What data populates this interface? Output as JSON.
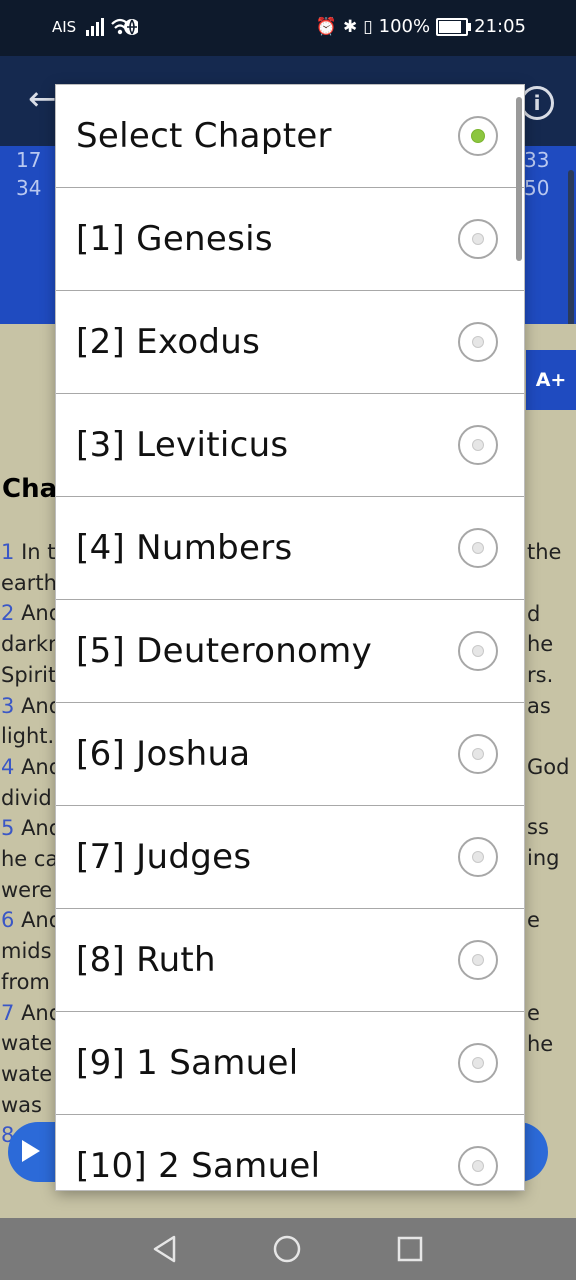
{
  "status_bar": {
    "carrier": "AIS",
    "battery": "100%",
    "time": "21:05",
    "battery_level": 1.0
  },
  "app_bar": {
    "back_icon": "arrow-back-icon",
    "info_icon": "info-icon",
    "info_glyph": "i"
  },
  "chapter_strip": {
    "visible_numbers": [
      "17",
      "33",
      "34",
      "50"
    ]
  },
  "reading": {
    "font_button": "A+",
    "chapter_heading_fragment": "Cha",
    "left_fragments": [
      {
        "num": "1",
        "text": "In t"
      },
      {
        "num": "",
        "text": "earth"
      },
      {
        "num": "2",
        "text": "And"
      },
      {
        "num": "",
        "text": "darkn"
      },
      {
        "num": "",
        "text": "Spirit"
      },
      {
        "num": "3",
        "text": "And"
      },
      {
        "num": "",
        "text": "light."
      },
      {
        "num": "4",
        "text": "And"
      },
      {
        "num": "",
        "text": "divid"
      },
      {
        "num": "5",
        "text": "And"
      },
      {
        "num": "",
        "text": "he ca"
      },
      {
        "num": "",
        "text": "were"
      },
      {
        "num": "6",
        "text": "And"
      },
      {
        "num": "",
        "text": "mids"
      },
      {
        "num": "",
        "text": "from"
      },
      {
        "num": "7",
        "text": "And"
      },
      {
        "num": "",
        "text": "wate"
      },
      {
        "num": "",
        "text": "wate"
      },
      {
        "num": "",
        "text": "was"
      },
      {
        "num": "8",
        "text": ""
      }
    ],
    "right_fragments": [
      "the",
      "d",
      "he",
      "rs.",
      "as",
      "God",
      "ss",
      "ing",
      "e",
      "e",
      "he"
    ]
  },
  "dialog": {
    "options": [
      {
        "label": "Select Chapter",
        "checked": true
      },
      {
        "label": "[1] Genesis",
        "checked": false
      },
      {
        "label": "[2] Exodus",
        "checked": false
      },
      {
        "label": "[3] Leviticus",
        "checked": false
      },
      {
        "label": "[4] Numbers",
        "checked": false
      },
      {
        "label": "[5] Deuteronomy",
        "checked": false
      },
      {
        "label": "[6] Joshua",
        "checked": false
      },
      {
        "label": "[7] Judges",
        "checked": false
      },
      {
        "label": "[8] Ruth",
        "checked": false
      },
      {
        "label": "[9] 1 Samuel",
        "checked": false
      },
      {
        "label": "[10] 2 Samuel",
        "checked": false
      }
    ]
  },
  "nav_bar": {
    "back_icon": "nav-back-icon",
    "home_icon": "nav-home-icon",
    "recents_icon": "nav-recents-icon"
  },
  "colors": {
    "status_bar": "#0e1a2c",
    "app_bar": "#15294f",
    "chapter_strip": "#1f4bc0",
    "reading_bg": "#c7c3a5",
    "radio_checked": "#8cc63f",
    "nav_bar": "#7a7a7a"
  }
}
